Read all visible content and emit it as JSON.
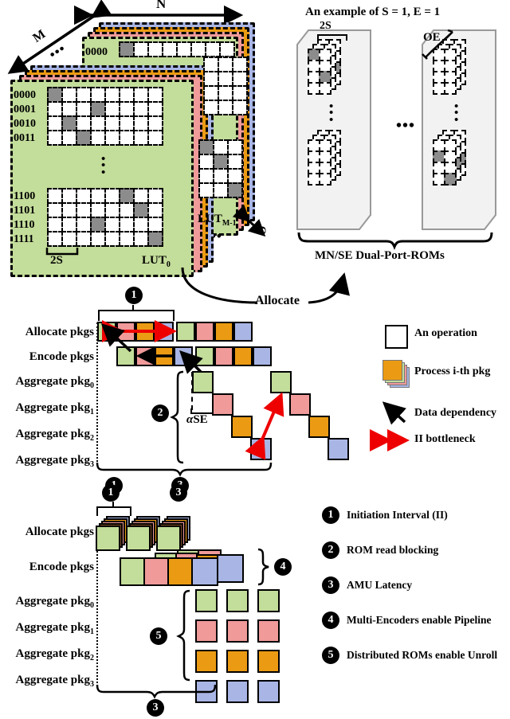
{
  "figure": {
    "top_left": {
      "axis_m": "M",
      "axis_n": "N",
      "axis_o": "O",
      "span_2s": "2S",
      "lut_first": "LUT",
      "lut_first_sub": "0",
      "lut_last": "LUT",
      "lut_last_sub": "M-1",
      "row_labels_top": [
        "0000",
        "0001",
        "0010",
        "0011"
      ],
      "row_labels_bottom": [
        "1100",
        "1101",
        "1110",
        "1111"
      ],
      "back_sheet_label": "0000",
      "ellipsis": "•••",
      "vertical_ellipsis": "⋮",
      "layer_colors": [
        "#c3dd9a",
        "#f09a9a",
        "#eb9b13",
        "#a9b6e5"
      ]
    },
    "top_right": {
      "title": "An example of S = 1, E = 1",
      "label_2s": "2S",
      "label_oe": "OE",
      "caption": "MN/SE Dual-Port-ROMs",
      "ellipsis": "•••"
    },
    "allocate_arrow_label": "Allocate",
    "middle": {
      "row_labels": [
        "Allocate pkgs",
        "Encode pkgs",
        "Aggregate pkg",
        "Aggregate pkg",
        "Aggregate pkg",
        "Aggregate pkg"
      ],
      "row_label_subs": [
        "",
        "",
        "0",
        "1",
        "2",
        "3"
      ],
      "alpha_se": "SE",
      "alpha_symbol": "α",
      "markers": {
        "ii_top": "1",
        "rom_blocking": "2",
        "ii_bottom": "1",
        "amu_latency": "3"
      },
      "pkg_colors": [
        "#c3dd9a",
        "#f09a9a",
        "#eb9b13",
        "#a9b6e5"
      ]
    },
    "legend_symbols": [
      {
        "icon": "empty-square-icon",
        "label": "An operation"
      },
      {
        "icon": "stacked-squares-icon",
        "label": "Process i-th pkg"
      },
      {
        "icon": "black-arrow-icon",
        "label": "Data dependency"
      },
      {
        "icon": "red-double-arrow-icon",
        "label": "II bottleneck"
      }
    ],
    "bottom": {
      "row_labels": [
        "Allocate pkgs",
        "Encode pkgs",
        "Aggregate pkg",
        "Aggregate pkg",
        "Aggregate pkg",
        "Aggregate pkg"
      ],
      "row_label_subs": [
        "",
        "",
        "0",
        "1",
        "2",
        "3"
      ],
      "markers": {
        "ii": "1",
        "amu_top": "3",
        "pipeline": "4",
        "unroll": "5",
        "amu_bottom": "3"
      }
    },
    "numbered_legend": [
      {
        "num": "1",
        "label": "Initiation Interval (II)"
      },
      {
        "num": "2",
        "label": "ROM read blocking"
      },
      {
        "num": "3",
        "label": "AMU Latency"
      },
      {
        "num": "4",
        "label": "Multi-Encoders enable Pipeline"
      },
      {
        "num": "5",
        "label": "Distributed ROMs enable Unroll"
      }
    ],
    "colors": {
      "green": "#c3dd9a",
      "pink": "#f09a9a",
      "orange": "#eb9b13",
      "blue": "#a9b6e5",
      "gray_cell": "#8c8c8c",
      "red": "#ee0000",
      "rom_bg": "#f2f2f2"
    }
  }
}
